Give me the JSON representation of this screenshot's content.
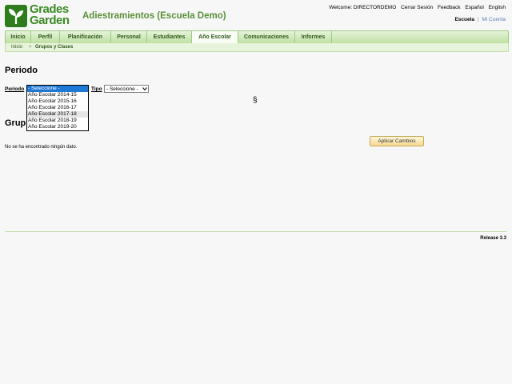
{
  "logo": {
    "line1": "Grades",
    "line2": "Garden"
  },
  "school_title": "Adiestramientos (Escuela Demo)",
  "top_links": {
    "welcome": "Welcome: DIRECTORDEMO",
    "logout": "Cerrar Sesión",
    "feedback": "Feedback",
    "spanish": "Español",
    "english": "English"
  },
  "school_links": {
    "school": "Escuela",
    "separator": "|",
    "account": "Mi Cuenta"
  },
  "nav": {
    "items": [
      {
        "label": "Inicio"
      },
      {
        "label": "Perfil"
      },
      {
        "label": "Planificación"
      },
      {
        "label": "Personal"
      },
      {
        "label": "Estudiantes"
      },
      {
        "label": "Año Escolar"
      },
      {
        "label": "Comunicaciones"
      },
      {
        "label": "Informes"
      }
    ],
    "active_index": 5
  },
  "breadcrumb": {
    "home": "Inicio",
    "separator": ">",
    "current": "Grupos y Clases"
  },
  "main": {
    "section_title": "Periodo",
    "periodo_label": "Periodo",
    "tipo_label": "Tipo",
    "tipo_select_value": "- Seleccione -",
    "periodo_options": [
      "- Seleccione -",
      "Año Escolar 2014-15",
      "Año Escolar 2015-16",
      "Año Escolar 2016-17",
      "Año Escolar 2017-18",
      "Año Escolar 2018-19",
      "Año Escolar 2019-20"
    ],
    "section_mark": "§",
    "group_title_visible": "Grup",
    "apply_button": "Aplicar Cambios",
    "no_data": "No se ha encontrado ningún dato."
  },
  "footer": {
    "release": "Release 3.3"
  },
  "colors": {
    "brand_green": "#3d8b25",
    "nav_bg": "#bfe0a3",
    "selected_option": "#1e78d6"
  }
}
